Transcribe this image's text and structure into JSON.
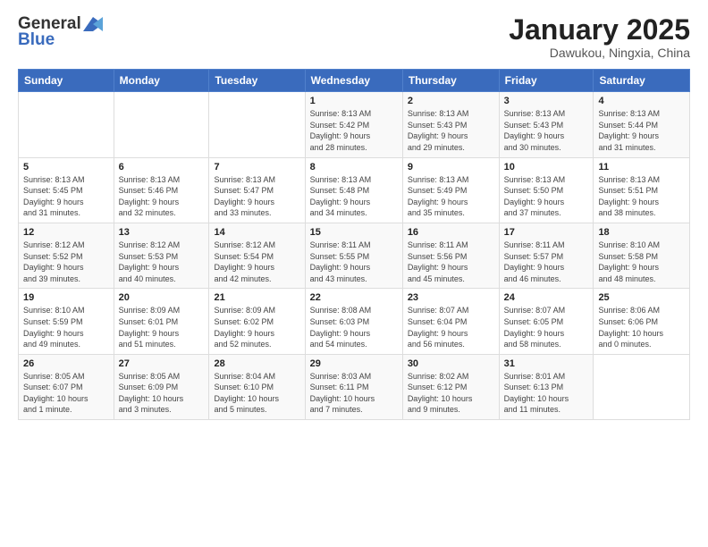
{
  "header": {
    "logo_general": "General",
    "logo_blue": "Blue",
    "month_title": "January 2025",
    "subtitle": "Dawukou, Ningxia, China"
  },
  "days_of_week": [
    "Sunday",
    "Monday",
    "Tuesday",
    "Wednesday",
    "Thursday",
    "Friday",
    "Saturday"
  ],
  "weeks": [
    [
      {
        "day": "",
        "info": ""
      },
      {
        "day": "",
        "info": ""
      },
      {
        "day": "",
        "info": ""
      },
      {
        "day": "1",
        "info": "Sunrise: 8:13 AM\nSunset: 5:42 PM\nDaylight: 9 hours\nand 28 minutes."
      },
      {
        "day": "2",
        "info": "Sunrise: 8:13 AM\nSunset: 5:43 PM\nDaylight: 9 hours\nand 29 minutes."
      },
      {
        "day": "3",
        "info": "Sunrise: 8:13 AM\nSunset: 5:43 PM\nDaylight: 9 hours\nand 30 minutes."
      },
      {
        "day": "4",
        "info": "Sunrise: 8:13 AM\nSunset: 5:44 PM\nDaylight: 9 hours\nand 31 minutes."
      }
    ],
    [
      {
        "day": "5",
        "info": "Sunrise: 8:13 AM\nSunset: 5:45 PM\nDaylight: 9 hours\nand 31 minutes."
      },
      {
        "day": "6",
        "info": "Sunrise: 8:13 AM\nSunset: 5:46 PM\nDaylight: 9 hours\nand 32 minutes."
      },
      {
        "day": "7",
        "info": "Sunrise: 8:13 AM\nSunset: 5:47 PM\nDaylight: 9 hours\nand 33 minutes."
      },
      {
        "day": "8",
        "info": "Sunrise: 8:13 AM\nSunset: 5:48 PM\nDaylight: 9 hours\nand 34 minutes."
      },
      {
        "day": "9",
        "info": "Sunrise: 8:13 AM\nSunset: 5:49 PM\nDaylight: 9 hours\nand 35 minutes."
      },
      {
        "day": "10",
        "info": "Sunrise: 8:13 AM\nSunset: 5:50 PM\nDaylight: 9 hours\nand 37 minutes."
      },
      {
        "day": "11",
        "info": "Sunrise: 8:13 AM\nSunset: 5:51 PM\nDaylight: 9 hours\nand 38 minutes."
      }
    ],
    [
      {
        "day": "12",
        "info": "Sunrise: 8:12 AM\nSunset: 5:52 PM\nDaylight: 9 hours\nand 39 minutes."
      },
      {
        "day": "13",
        "info": "Sunrise: 8:12 AM\nSunset: 5:53 PM\nDaylight: 9 hours\nand 40 minutes."
      },
      {
        "day": "14",
        "info": "Sunrise: 8:12 AM\nSunset: 5:54 PM\nDaylight: 9 hours\nand 42 minutes."
      },
      {
        "day": "15",
        "info": "Sunrise: 8:11 AM\nSunset: 5:55 PM\nDaylight: 9 hours\nand 43 minutes."
      },
      {
        "day": "16",
        "info": "Sunrise: 8:11 AM\nSunset: 5:56 PM\nDaylight: 9 hours\nand 45 minutes."
      },
      {
        "day": "17",
        "info": "Sunrise: 8:11 AM\nSunset: 5:57 PM\nDaylight: 9 hours\nand 46 minutes."
      },
      {
        "day": "18",
        "info": "Sunrise: 8:10 AM\nSunset: 5:58 PM\nDaylight: 9 hours\nand 48 minutes."
      }
    ],
    [
      {
        "day": "19",
        "info": "Sunrise: 8:10 AM\nSunset: 5:59 PM\nDaylight: 9 hours\nand 49 minutes."
      },
      {
        "day": "20",
        "info": "Sunrise: 8:09 AM\nSunset: 6:01 PM\nDaylight: 9 hours\nand 51 minutes."
      },
      {
        "day": "21",
        "info": "Sunrise: 8:09 AM\nSunset: 6:02 PM\nDaylight: 9 hours\nand 52 minutes."
      },
      {
        "day": "22",
        "info": "Sunrise: 8:08 AM\nSunset: 6:03 PM\nDaylight: 9 hours\nand 54 minutes."
      },
      {
        "day": "23",
        "info": "Sunrise: 8:07 AM\nSunset: 6:04 PM\nDaylight: 9 hours\nand 56 minutes."
      },
      {
        "day": "24",
        "info": "Sunrise: 8:07 AM\nSunset: 6:05 PM\nDaylight: 9 hours\nand 58 minutes."
      },
      {
        "day": "25",
        "info": "Sunrise: 8:06 AM\nSunset: 6:06 PM\nDaylight: 10 hours\nand 0 minutes."
      }
    ],
    [
      {
        "day": "26",
        "info": "Sunrise: 8:05 AM\nSunset: 6:07 PM\nDaylight: 10 hours\nand 1 minute."
      },
      {
        "day": "27",
        "info": "Sunrise: 8:05 AM\nSunset: 6:09 PM\nDaylight: 10 hours\nand 3 minutes."
      },
      {
        "day": "28",
        "info": "Sunrise: 8:04 AM\nSunset: 6:10 PM\nDaylight: 10 hours\nand 5 minutes."
      },
      {
        "day": "29",
        "info": "Sunrise: 8:03 AM\nSunset: 6:11 PM\nDaylight: 10 hours\nand 7 minutes."
      },
      {
        "day": "30",
        "info": "Sunrise: 8:02 AM\nSunset: 6:12 PM\nDaylight: 10 hours\nand 9 minutes."
      },
      {
        "day": "31",
        "info": "Sunrise: 8:01 AM\nSunset: 6:13 PM\nDaylight: 10 hours\nand 11 minutes."
      },
      {
        "day": "",
        "info": ""
      }
    ]
  ]
}
